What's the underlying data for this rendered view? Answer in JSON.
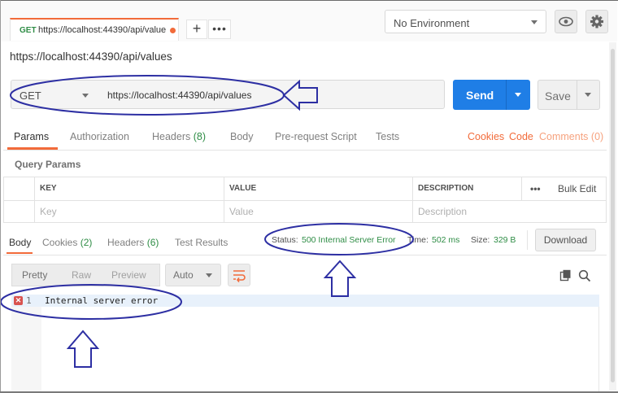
{
  "tab": {
    "method": "GET",
    "url": "https://localhost:44390/api/value",
    "add_label": "+",
    "more_label": "•••"
  },
  "environment": {
    "selected": "No Environment"
  },
  "icons": {
    "eye": "eye-icon",
    "gear": "gear-icon",
    "copy": "copy-icon",
    "search": "search-icon",
    "wrap": "wrap-lines-icon",
    "error": "error-icon"
  },
  "request": {
    "title": "https://localhost:44390/api/values",
    "method": "GET",
    "url": "https://localhost:44390/api/values",
    "send_label": "Send",
    "save_label": "Save"
  },
  "request_tabs": {
    "params": "Params",
    "authorization": "Authorization",
    "headers": "Headers",
    "headers_count": "(8)",
    "body": "Body",
    "prerequest": "Pre-request Script",
    "tests": "Tests",
    "cookies": "Cookies",
    "code": "Code",
    "comments": "Comments (0)"
  },
  "query_params": {
    "title": "Query Params",
    "columns": [
      "KEY",
      "VALUE",
      "DESCRIPTION"
    ],
    "more": "•••",
    "bulk_edit": "Bulk Edit",
    "placeholders": [
      "Key",
      "Value",
      "Description"
    ]
  },
  "response_tabs": {
    "body": "Body",
    "cookies": "Cookies",
    "cookies_count": "(2)",
    "headers": "Headers",
    "headers_count": "(6)",
    "test_results": "Test Results"
  },
  "status": {
    "status_label": "Status:",
    "status_value": "500 Internal Server Error",
    "time_label": "Time:",
    "time_value": "502 ms",
    "size_label": "Size:",
    "size_value": "329 B",
    "download_label": "Download"
  },
  "format": {
    "pretty": "Pretty",
    "raw": "Raw",
    "preview": "Preview",
    "auto": "Auto"
  },
  "editor": {
    "line_number": "1",
    "line_text": "Internal server error"
  },
  "colors": {
    "accent": "#f26b3a",
    "send": "#1f7ee6",
    "success_text": "#2f8d46",
    "annotation": "#2d2fa3",
    "error": "#d9534f"
  }
}
